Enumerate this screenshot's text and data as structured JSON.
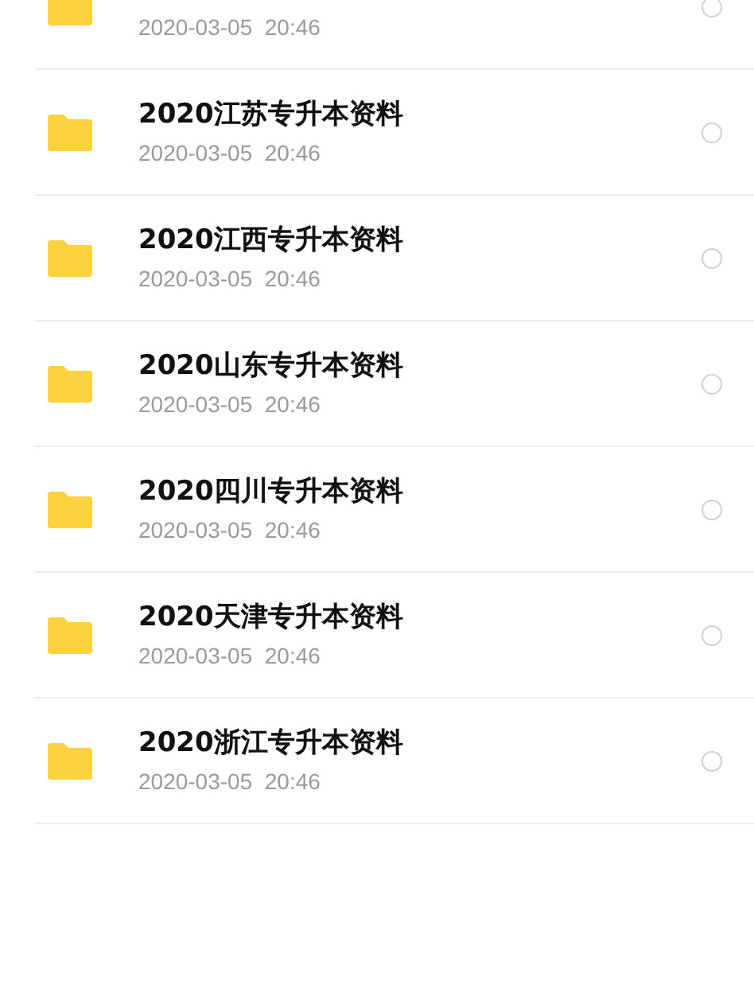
{
  "files": [
    {
      "date": "2020-03-05  20:46",
      "selected": false
    },
    {
      "name": "2020江苏专升本资料",
      "date": "2020-03-05  20:46",
      "selected": false
    },
    {
      "name": "2020江西专升本资料",
      "date": "2020-03-05  20:46",
      "selected": false
    },
    {
      "name": "2020山东专升本资料",
      "date": "2020-03-05  20:46",
      "selected": false
    },
    {
      "name": "2020四川专升本资料",
      "date": "2020-03-05  20:46",
      "selected": false
    },
    {
      "name": "2020天津专升本资料",
      "date": "2020-03-05  20:46",
      "selected": false
    },
    {
      "name": "2020浙江专升本资料",
      "date": "2020-03-05  20:46",
      "selected": false
    }
  ]
}
